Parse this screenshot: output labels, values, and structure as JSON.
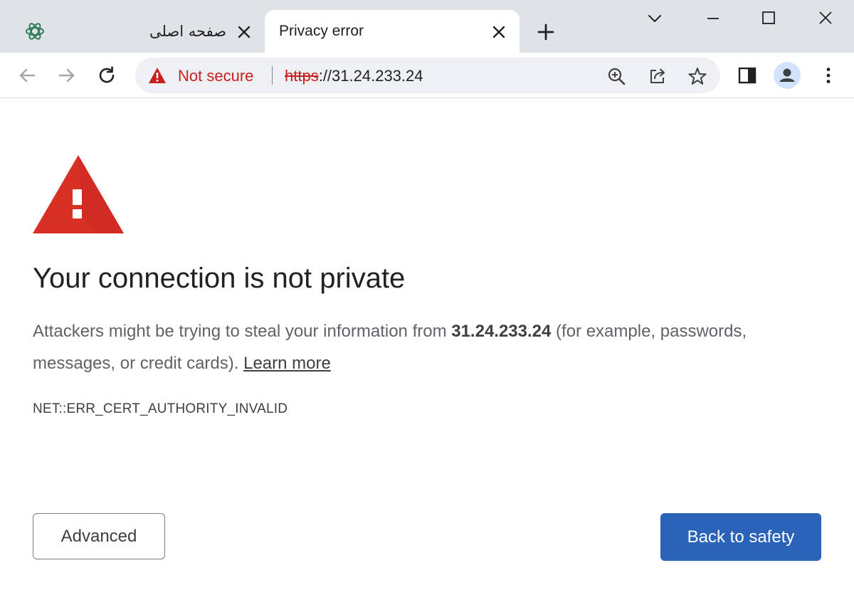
{
  "browser": {
    "tabs": [
      {
        "title": "صفحه اصلی",
        "active": false,
        "icon": "site-favicon"
      },
      {
        "title": "Privacy error",
        "active": true
      }
    ],
    "new_tab_icon": "plus-icon",
    "window_controls": [
      "tab-search-icon",
      "minimize-icon",
      "maximize-icon",
      "close-icon"
    ],
    "omnibox": {
      "security_label": "Not secure",
      "url_scheme": "https",
      "url_rest": "://31.24.233.24",
      "icons": [
        "zoom-icon",
        "share-icon",
        "bookmark-star-icon"
      ]
    },
    "toolbar_icons": [
      "back-icon",
      "forward-icon",
      "reload-icon",
      "side-panel-icon",
      "profile-icon",
      "menu-icon"
    ]
  },
  "page": {
    "heading": "Your connection is not private",
    "explanation_before": "Attackers might be trying to steal your information from ",
    "host": "31.24.233.24",
    "explanation_after": " (for example, passwords, messages, or credit cards). ",
    "learn_more": "Learn more",
    "error_code": "NET::ERR_CERT_AUTHORITY_INVALID",
    "advanced_button": "Advanced",
    "back_button": "Back to safety"
  },
  "colors": {
    "warning_red": "#d93025",
    "not_secure_red": "#c5221f",
    "primary_blue": "#2a63b8",
    "tabstrip_bg": "#dfe3e8"
  }
}
